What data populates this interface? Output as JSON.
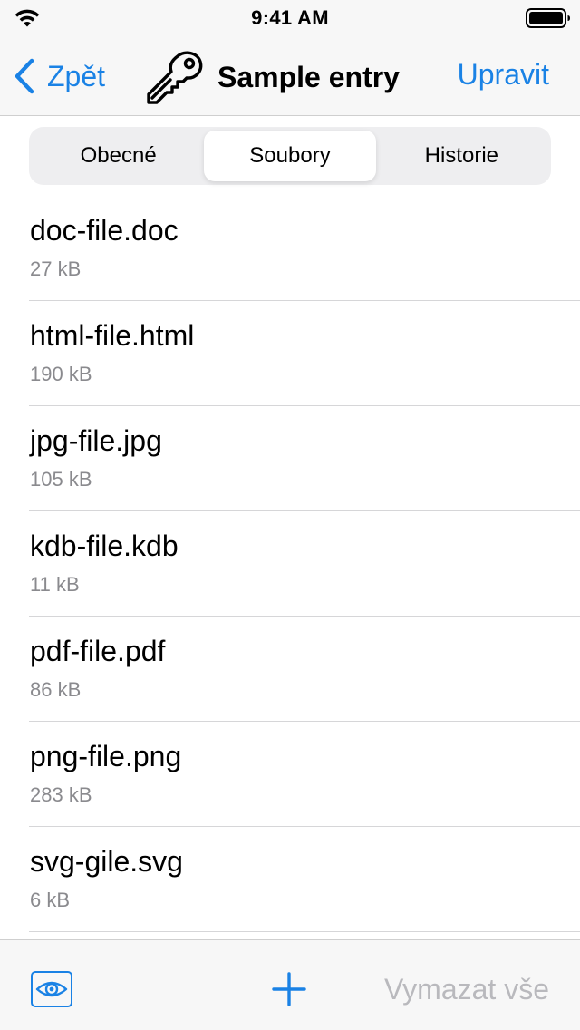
{
  "status_bar": {
    "time": "9:41 AM"
  },
  "nav": {
    "back_label": "Zpět",
    "title": "Sample entry",
    "edit_label": "Upravit"
  },
  "segments": [
    {
      "label": "Obecné",
      "selected": false
    },
    {
      "label": "Soubory",
      "selected": true
    },
    {
      "label": "Historie",
      "selected": false
    }
  ],
  "files": [
    {
      "name": "doc-file.doc",
      "size": "27 kB"
    },
    {
      "name": "html-file.html",
      "size": "190 kB"
    },
    {
      "name": "jpg-file.jpg",
      "size": "105 kB"
    },
    {
      "name": "kdb-file.kdb",
      "size": "11 kB"
    },
    {
      "name": "pdf-file.pdf",
      "size": "86 kB"
    },
    {
      "name": "png-file.png",
      "size": "283 kB"
    },
    {
      "name": "svg-gile.svg",
      "size": "6 kB"
    }
  ],
  "toolbar": {
    "clear_label": "Vymazat vše",
    "clear_enabled": false
  },
  "colors": {
    "accent": "#1a82e5",
    "disabled": "#b9b9bd",
    "secondary_text": "#8a8a8e"
  },
  "icons": {
    "back": "chevron-left-icon",
    "entry": "key-icon",
    "show": "eye-icon",
    "add": "plus-icon",
    "wifi": "wifi-icon",
    "battery": "battery-icon"
  }
}
